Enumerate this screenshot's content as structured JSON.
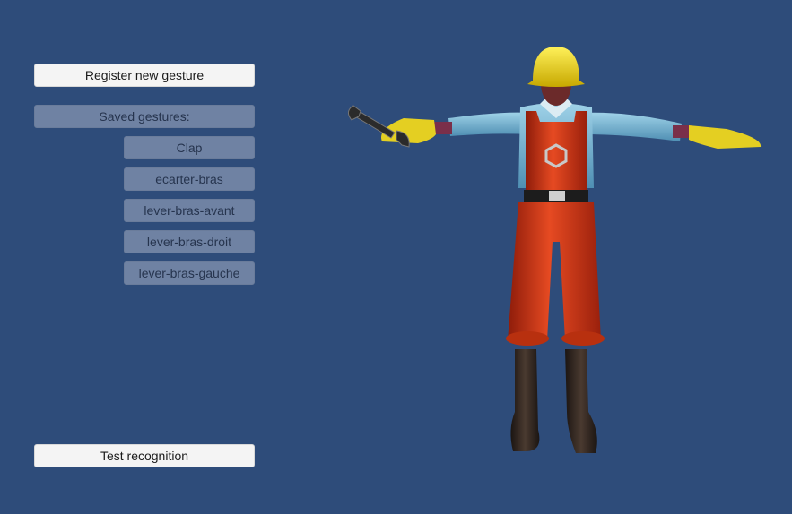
{
  "panel": {
    "register_label": "Register new gesture",
    "saved_label": "Saved gestures:",
    "gestures": [
      {
        "label": "Clap"
      },
      {
        "label": "ecarter-bras"
      },
      {
        "label": "lever-bras-avant"
      },
      {
        "label": "lever-bras-droit"
      },
      {
        "label": "lever-bras-gauche"
      }
    ],
    "test_label": "Test recognition"
  },
  "colors": {
    "background": "#2e4c7a",
    "primary_button": "#f4f4f4",
    "muted_button": "#6f82a3"
  }
}
